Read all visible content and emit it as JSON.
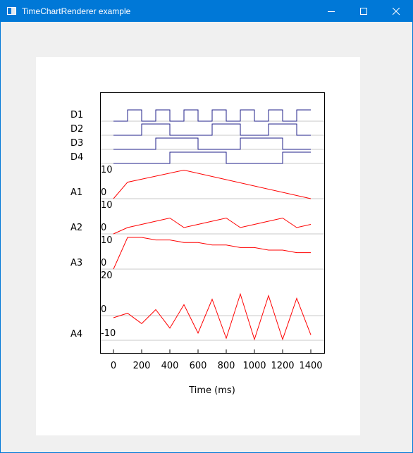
{
  "window": {
    "title": "TimeChartRenderer example",
    "icons": {
      "app": "app-window-icon",
      "minimize": "minimize-icon",
      "maximize": "maximize-icon",
      "close": "close-icon"
    },
    "colors": {
      "titlebar": "#0078d7",
      "client": "#f0f0f0",
      "canvas": "#ffffff"
    }
  },
  "chart_data": {
    "type": "line",
    "title": "",
    "xlabel": "Time (ms)",
    "ylabel": "",
    "xlim": [
      -80,
      1480
    ],
    "x_ticks": [
      0,
      200,
      400,
      600,
      800,
      1000,
      1200,
      1400
    ],
    "x_tick_labels": [
      "0",
      "200",
      "400",
      "600",
      "800",
      "1000",
      "1200",
      "1400"
    ],
    "grid": "horizontal separators between signal rows",
    "colors": {
      "digital": "#1f1f8a",
      "analog": "#ff0000",
      "separator": "#c8c8c8",
      "frame": "#000000"
    },
    "digital_series": [
      {
        "name": "D1",
        "x": [
          0,
          100,
          100,
          200,
          200,
          300,
          300,
          400,
          400,
          500,
          500,
          600,
          600,
          700,
          700,
          800,
          800,
          900,
          900,
          1000,
          1000,
          1100,
          1100,
          1200,
          1200,
          1300,
          1300,
          1400
        ],
        "y": [
          0,
          0,
          1,
          1,
          0,
          0,
          1,
          1,
          0,
          0,
          1,
          1,
          0,
          0,
          1,
          1,
          0,
          0,
          1,
          1,
          0,
          0,
          1,
          1,
          0,
          0,
          1,
          1
        ]
      },
      {
        "name": "D2",
        "x": [
          0,
          200,
          200,
          400,
          400,
          700,
          700,
          900,
          900,
          1100,
          1100,
          1300,
          1300,
          1400
        ],
        "y": [
          0,
          0,
          1,
          1,
          0,
          0,
          1,
          1,
          0,
          0,
          1,
          1,
          0,
          0
        ]
      },
      {
        "name": "D3",
        "x": [
          0,
          300,
          300,
          600,
          600,
          900,
          900,
          1200,
          1200,
          1400
        ],
        "y": [
          0,
          0,
          1,
          1,
          0,
          0,
          1,
          1,
          0,
          0
        ]
      },
      {
        "name": "D4",
        "x": [
          0,
          400,
          400,
          800,
          800,
          1200,
          1200,
          1400
        ],
        "y": [
          0,
          0,
          1,
          1,
          0,
          0,
          1,
          1
        ]
      }
    ],
    "analog_series": [
      {
        "name": "A1",
        "ylim": [
          0,
          10
        ],
        "tick_labels": [
          "10",
          "0"
        ],
        "x": [
          0,
          100,
          500,
          1400
        ],
        "y": [
          0,
          5.2,
          9,
          0
        ]
      },
      {
        "name": "A2",
        "ylim": [
          0,
          10
        ],
        "tick_labels": [
          "10",
          "0"
        ],
        "x": [
          0,
          100,
          200,
          300,
          400,
          500,
          600,
          700,
          800,
          900,
          1000,
          1100,
          1200,
          1300,
          1400
        ],
        "y": [
          0,
          2,
          3,
          4,
          5,
          2,
          3,
          4,
          5,
          2,
          3,
          4,
          5,
          2,
          3
        ]
      },
      {
        "name": "A3",
        "ylim": [
          0,
          10
        ],
        "tick_labels": [
          "10",
          "0"
        ],
        "x": [
          0,
          100,
          200,
          300,
          400,
          500,
          600,
          700,
          800,
          900,
          1000,
          1100,
          1200,
          1300,
          1400
        ],
        "y": [
          0,
          10,
          10,
          9.2,
          9.2,
          8.4,
          8.4,
          7.6,
          7.6,
          6.8,
          6.8,
          6,
          6,
          5.2,
          5.2
        ]
      },
      {
        "name": "A4",
        "ylim": [
          -10,
          20
        ],
        "tick_labels": [
          "20",
          "0",
          "-10"
        ],
        "x": [
          0,
          100,
          200,
          300,
          400,
          500,
          600,
          700,
          800,
          900,
          1000,
          1100,
          1200,
          1300,
          1400
        ],
        "y": [
          0,
          2,
          -2.6,
          3.6,
          -4.6,
          5.8,
          -6.8,
          8.2,
          -9.1,
          10.5,
          -9.6,
          9.8,
          -9.6,
          8.6,
          -7.6
        ]
      }
    ]
  }
}
